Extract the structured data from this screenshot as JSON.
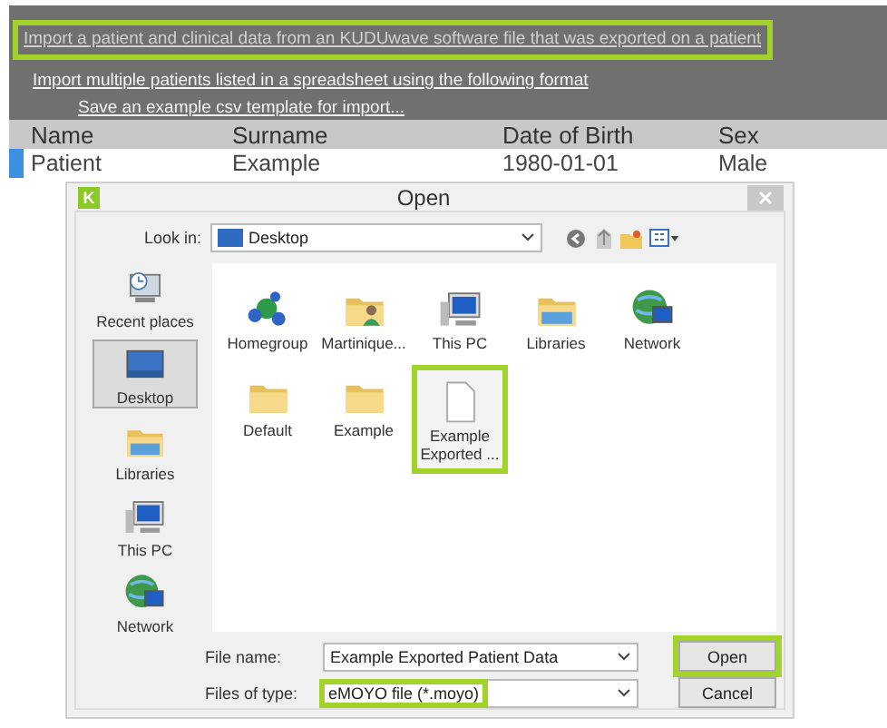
{
  "top_panel": {
    "links": [
      {
        "text": "Import a patient and clinical data from an KUDUwave software file that was exported on a patient",
        "kind": "primary",
        "highlighted": true
      },
      {
        "text": "Import multiple patients listed in a spreadsheet using the following format",
        "kind": "primary",
        "highlighted": false
      },
      {
        "text": "Save an example csv template for import...",
        "kind": "sub",
        "highlighted": false
      }
    ]
  },
  "table": {
    "columns": [
      "Name",
      "Surname",
      "Date of Birth",
      "Sex"
    ],
    "rows": [
      {
        "cells": [
          "Patient",
          "Example",
          "1980-01-01",
          "Male"
        ],
        "selected": true
      }
    ]
  },
  "dialog": {
    "app_icon_letter": "K",
    "title": "Open",
    "look_in": {
      "label": "Look in:",
      "value": "Desktop"
    },
    "places": [
      {
        "label": "Recent places",
        "kind": "recent",
        "selected": false
      },
      {
        "label": "Desktop",
        "kind": "desktop",
        "selected": true
      },
      {
        "label": "Libraries",
        "kind": "libraries",
        "selected": false
      },
      {
        "label": "This PC",
        "kind": "computer",
        "selected": false
      },
      {
        "label": "Network",
        "kind": "network",
        "selected": false
      }
    ],
    "files": [
      {
        "label": "Homegroup",
        "kind": "homegroup",
        "highlighted": false
      },
      {
        "label": "Martinique...",
        "kind": "user-folder",
        "highlighted": false
      },
      {
        "label": "This PC",
        "kind": "computer",
        "highlighted": false
      },
      {
        "label": "Libraries",
        "kind": "libraries",
        "highlighted": false
      },
      {
        "label": "Network",
        "kind": "network",
        "highlighted": false
      },
      {
        "label": "Default",
        "kind": "folder",
        "highlighted": false
      },
      {
        "label": "Example",
        "kind": "folder",
        "highlighted": false
      },
      {
        "label": "Example Exported ...",
        "kind": "document",
        "highlighted": true
      }
    ],
    "file_name": {
      "label": "File name:",
      "value": "Example Exported Patient Data"
    },
    "file_type": {
      "label": "Files of type:",
      "value": "eMOYO file (*.moyo)",
      "highlighted": true
    },
    "buttons": [
      {
        "label": "Open",
        "highlighted": true
      },
      {
        "label": "Cancel",
        "highlighted": false
      }
    ]
  }
}
